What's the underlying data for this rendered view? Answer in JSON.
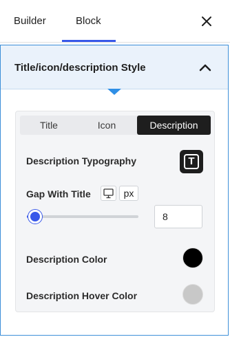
{
  "tabs": {
    "builder": "Builder",
    "block": "Block"
  },
  "panel": {
    "title": "Title/icon/description Style"
  },
  "segmented": {
    "items": [
      "Title",
      "Icon",
      "Description"
    ],
    "active": "Description"
  },
  "typography": {
    "label": "Description Typography",
    "icon_letter": "T"
  },
  "gap": {
    "label": "Gap With Title",
    "unit": "px",
    "value": "8",
    "slider_fraction": 0.08
  },
  "color": {
    "label": "Description Color",
    "value": "#000000"
  },
  "hover_color": {
    "label": "Description Hover Color",
    "value": "#c8c8c8"
  },
  "colors": {
    "accent": "#3858e9",
    "panel_border": "#3b8ed8",
    "active_segment": "#1e1e1e"
  }
}
